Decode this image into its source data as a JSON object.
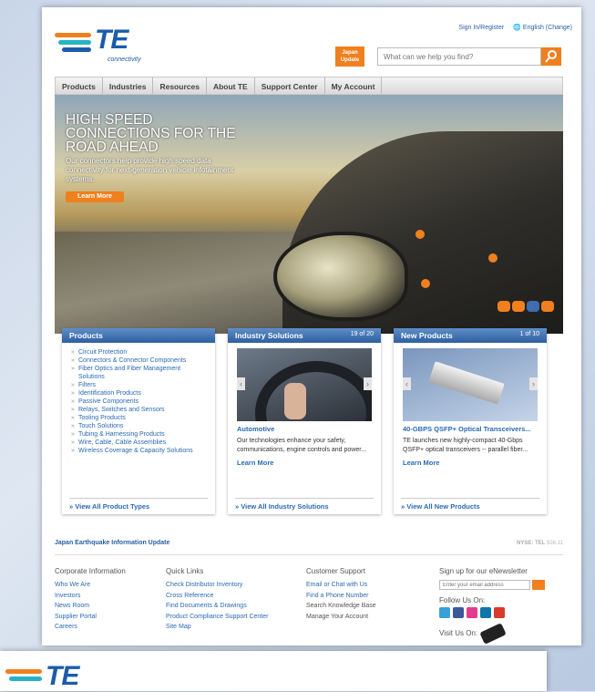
{
  "header": {
    "logo_text": "TE",
    "logo_sub": "connectivity",
    "sign_in": "Sign In/Register",
    "language": "English (Change)",
    "japan_update": [
      "Japan",
      "Update"
    ],
    "search_placeholder": "What can we help you find?"
  },
  "nav": [
    "Products",
    "Industries",
    "Resources",
    "About TE",
    "Support Center",
    "My Account"
  ],
  "hero": {
    "title": "HIGH SPEED CONNECTIONS FOR THE ROAD AHEAD",
    "text": "Our connectors help provide high speed data connectivity for next-generation vehicle infotainment systems.",
    "button": "Learn More"
  },
  "products": {
    "title": "Products",
    "items": [
      "Circuit Protection",
      "Connectors & Connector Components",
      "Fiber Optics and Fiber Management Solutions",
      "Filters",
      "Identification Products",
      "Passive Components",
      "Relays, Switches and Sensors",
      "Tooling Products",
      "Touch Solutions",
      "Tubing & Harnessing Products",
      "Wire, Cable, Cable Assemblies",
      "Wireless Coverage & Capacity Solutions"
    ],
    "footer": "View All Product Types"
  },
  "industry": {
    "title": "Industry Solutions",
    "count": "19 of 20",
    "item_title": "Automotive",
    "item_text": "Our technologies enhance your safety, communications, engine controls and power...",
    "learn": "Learn More",
    "footer": "View All Industry Solutions"
  },
  "newproducts": {
    "title": "New Products",
    "count": "1 of 10",
    "item_title": "40-GBPS QSFP+ Optical Transceivers...",
    "item_text": "TE launches new highly-compact 40-Gbps QSFP+ optical transceivers -- parallel fiber...",
    "learn": "Learn More",
    "footer": "View All New Products"
  },
  "lower": {
    "quake": "Japan Earthquake Information Update",
    "nyse_label": "NYSE: TEL",
    "nyse_value": "$36.11"
  },
  "footer": {
    "corporate": {
      "title": "Corporate Information",
      "links": [
        "Who We Are",
        "Investors",
        "News Room",
        "Supplier Portal",
        "Careers"
      ]
    },
    "quick": {
      "title": "Quick Links",
      "links": [
        "Check Distributor Inventory",
        "Cross Reference",
        "Find Documents & Drawings",
        "Product Compliance Support Center",
        "Site Map"
      ]
    },
    "support": {
      "title": "Customer Support",
      "links": [
        "Email or Chat with Us",
        "Find a Phone Number",
        "Search Knowledge Base",
        "Manage Your Account"
      ]
    },
    "news": {
      "title": "Sign up for our eNewsletter",
      "placeholder": "Enter your email address",
      "follow": "Follow Us On:",
      "visit": "Visit Us On:"
    }
  },
  "colors": {
    "brand_blue": "#1b5cab",
    "accent_orange": "#f0801e",
    "teal": "#27b3c4"
  }
}
